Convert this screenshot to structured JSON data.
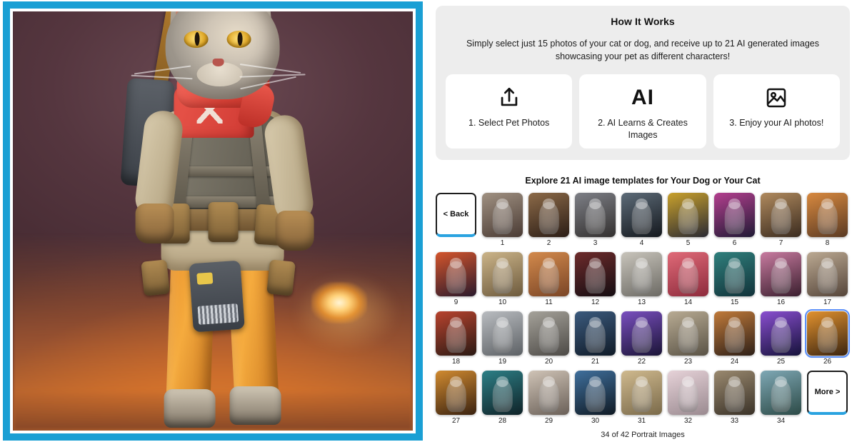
{
  "theme": {
    "frame_blue": "#1a9fd4",
    "accent_blue": "#2aa3e0",
    "selection_blue": "#5b8ff9",
    "panel_gray": "#ededed"
  },
  "preview": {
    "name": "pet-ai-portrait-preview",
    "alt": "AI generated portrait of a gray tabby cat as a soldier character with red scarf, tactical vest and rifle, against an orange smoky battlefield background"
  },
  "how_it_works": {
    "title": "How It Works",
    "subtitle": "Simply select just 15 photos of your cat or dog, and receive up to 21 AI generated images showcasing your pet as different characters!",
    "steps": [
      {
        "icon": "upload-icon",
        "icon_glyph": "",
        "label": "1. Select Pet Photos"
      },
      {
        "icon": "ai-icon",
        "icon_glyph": "AI",
        "label": "2. AI Learns & Creates Images"
      },
      {
        "icon": "image-icon",
        "icon_glyph": "",
        "label": "3. Enjoy your AI photos!"
      }
    ]
  },
  "gallery": {
    "title": "Explore 21 AI image templates for Your Dog or Your Cat",
    "back_label": "< Back",
    "more_label": "More >",
    "footer": "34 of 42 Portrait Images",
    "selected_index": 26,
    "rows": [
      [
        {
          "n": "1",
          "c1": "#a09182",
          "c2": "#4a3b34"
        },
        {
          "n": "2",
          "c1": "#8c6a48",
          "c2": "#2b1d16"
        },
        {
          "n": "3",
          "c1": "#7d7f86",
          "c2": "#33302f"
        },
        {
          "n": "4",
          "c1": "#5d6b78",
          "c2": "#14181d"
        },
        {
          "n": "5",
          "c1": "#c9a12c",
          "c2": "#2a2a33"
        },
        {
          "n": "6",
          "c1": "#b33f8e",
          "c2": "#201a35"
        },
        {
          "n": "7",
          "c1": "#b08a5e",
          "c2": "#3a2b1f"
        },
        {
          "n": "8",
          "c1": "#d8893f",
          "c2": "#5a3a23"
        }
      ],
      [
        {
          "n": "9",
          "c1": "#d4552c",
          "c2": "#2a1a2c"
        },
        {
          "n": "10",
          "c1": "#cbb489",
          "c2": "#6d5a3d"
        },
        {
          "n": "11",
          "c1": "#d38a4c",
          "c2": "#7a4526"
        },
        {
          "n": "12",
          "c1": "#6d2b2b",
          "c2": "#150d12"
        },
        {
          "n": "13",
          "c1": "#c8c4bb",
          "c2": "#6c6a64"
        },
        {
          "n": "14",
          "c1": "#e06a78",
          "c2": "#8d2b3c"
        },
        {
          "n": "15",
          "c1": "#2f7f7c",
          "c2": "#12333a"
        },
        {
          "n": "16",
          "c1": "#c87ba0",
          "c2": "#3a1f2e"
        },
        {
          "n": "17",
          "c1": "#bba992",
          "c2": "#55453a"
        }
      ],
      [
        {
          "n": "18",
          "c1": "#b8432e",
          "c2": "#2a1a14"
        },
        {
          "n": "19",
          "c1": "#b9bcc0",
          "c2": "#5d6165"
        },
        {
          "n": "20",
          "c1": "#a5a29a",
          "c2": "#4d4a46"
        },
        {
          "n": "21",
          "c1": "#3b5a7d",
          "c2": "#101b28"
        },
        {
          "n": "22",
          "c1": "#7a4fbf",
          "c2": "#1a1436"
        },
        {
          "n": "23",
          "c1": "#b8ab93",
          "c2": "#5a5346"
        },
        {
          "n": "24",
          "c1": "#c07a3a",
          "c2": "#2e2018"
        },
        {
          "n": "25",
          "c1": "#8a4fd0",
          "c2": "#15123a"
        },
        {
          "n": "26",
          "c1": "#e2922f",
          "c2": "#3a2410"
        }
      ],
      [
        {
          "n": "27",
          "c1": "#d08a30",
          "c2": "#3a2210"
        },
        {
          "n": "28",
          "c1": "#2d7f86",
          "c2": "#0f2227"
        },
        {
          "n": "29",
          "c1": "#cfc3b6",
          "c2": "#6a6058"
        },
        {
          "n": "30",
          "c1": "#3f6f9c",
          "c2": "#101a24"
        },
        {
          "n": "31",
          "c1": "#cfb98e",
          "c2": "#7a6a4a"
        },
        {
          "n": "32",
          "c1": "#e6d2d8",
          "c2": "#9a8a90"
        },
        {
          "n": "33",
          "c1": "#9a896f",
          "c2": "#3a3228"
        },
        {
          "n": "34",
          "c1": "#7fa8b5",
          "c2": "#2c4a46"
        }
      ]
    ]
  }
}
